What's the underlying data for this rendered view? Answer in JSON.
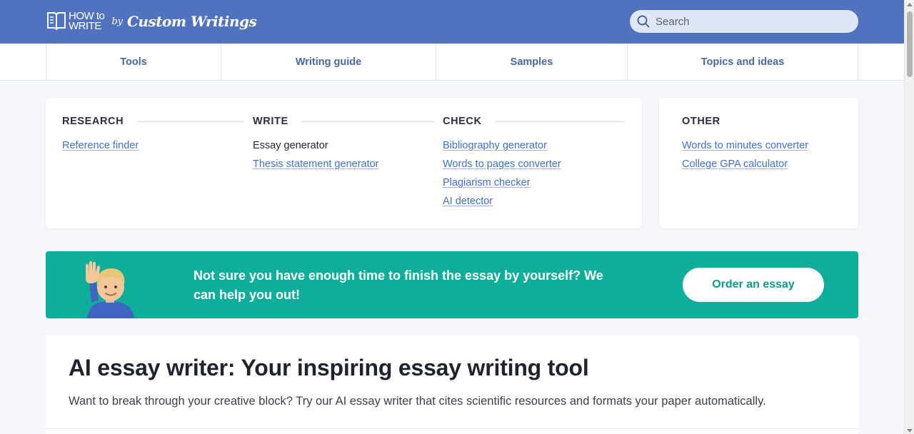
{
  "header": {
    "logo": {
      "line1": "HOW to",
      "line2": "WRITE",
      "by": "by",
      "brand": "Custom Writings"
    },
    "search": {
      "placeholder": "Search"
    }
  },
  "nav": {
    "tabs": [
      {
        "label": "Tools"
      },
      {
        "label": "Writing guide"
      },
      {
        "label": "Samples"
      },
      {
        "label": "Topics and ideas"
      }
    ]
  },
  "menu": {
    "research": {
      "title": "RESEARCH",
      "links": [
        "Reference finder"
      ]
    },
    "write": {
      "title": "WRITE",
      "links": [
        "Essay generator",
        "Thesis statement generator"
      ]
    },
    "check": {
      "title": "CHECK",
      "links": [
        "Bibliography generator",
        "Words to pages converter",
        "Plagiarism checker",
        "AI detector"
      ]
    },
    "other": {
      "title": "OTHER",
      "links": [
        "Words to minutes converter",
        "College GPA calculator"
      ]
    }
  },
  "promo": {
    "text": "Not sure you have enough time to finish the essay by yourself? We can help you out!",
    "button": "Order an essay"
  },
  "article": {
    "title": "AI essay writer: Your inspiring essay writing tool",
    "subtitle": "Want to break through your creative block? Try our AI essay writer that cites scientific resources and formats your paper automatically."
  },
  "colors": {
    "header_bg": "#5173bf",
    "link": "#3f6fd6",
    "promo_bg": "#0eae9b",
    "nav_text": "#4b67aa"
  }
}
